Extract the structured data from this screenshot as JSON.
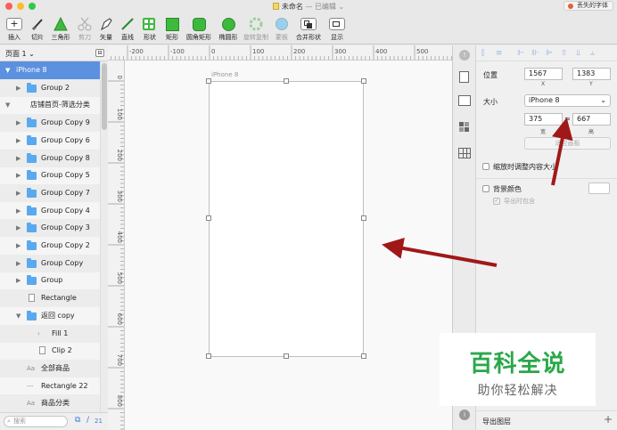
{
  "window": {
    "title": "未命名",
    "title_suffix": "— 已编辑",
    "lost_fonts": "丢失的字体"
  },
  "toolbar": [
    {
      "id": "insert",
      "label": "插入",
      "icon": "plus-icon"
    },
    {
      "id": "slice",
      "label": "切片",
      "icon": "knife-icon"
    },
    {
      "id": "triangle",
      "label": "三角形",
      "icon": "triangle-icon"
    },
    {
      "id": "scissors",
      "label": "剪刀",
      "icon": "scissors-icon",
      "disabled": true
    },
    {
      "id": "vector",
      "label": "矢量",
      "icon": "pen-icon"
    },
    {
      "id": "line",
      "label": "直线",
      "icon": "line-icon"
    },
    {
      "id": "shape",
      "label": "形状",
      "icon": "shapes-icon"
    },
    {
      "id": "rect",
      "label": "矩形",
      "icon": "rectangle-icon"
    },
    {
      "id": "roundrect",
      "label": "圆角矩形",
      "icon": "rounded-rectangle-icon"
    },
    {
      "id": "oval",
      "label": "椭圆形",
      "icon": "oval-icon"
    },
    {
      "id": "rotatecopy",
      "label": "旋转复制",
      "icon": "gear-icon",
      "disabled": true
    },
    {
      "id": "mask",
      "label": "蒙板",
      "icon": "mask-icon",
      "disabled": true
    },
    {
      "id": "combine",
      "label": "合并形状",
      "icon": "combine-icon"
    },
    {
      "id": "view",
      "label": "显示",
      "icon": "view-icon"
    }
  ],
  "page_selector": "页面 1",
  "layers": [
    {
      "name": "iPhone 8",
      "arrow": "▼",
      "selected": true
    },
    {
      "name": "Group 2",
      "arrow": "▶",
      "folder": true
    },
    {
      "name": "店铺首页-筛选分类",
      "arrow": "▼"
    },
    {
      "name": "Group Copy 9",
      "arrow": "▶",
      "folder": true
    },
    {
      "name": "Group Copy 6",
      "arrow": "▶",
      "folder": true
    },
    {
      "name": "Group Copy 8",
      "arrow": "▶",
      "folder": true
    },
    {
      "name": "Group Copy 5",
      "arrow": "▶",
      "folder": true
    },
    {
      "name": "Group Copy 7",
      "arrow": "▶",
      "folder": true
    },
    {
      "name": "Group Copy 4",
      "arrow": "▶",
      "folder": true
    },
    {
      "name": "Group Copy 3",
      "arrow": "▶",
      "folder": true
    },
    {
      "name": "Group Copy 2",
      "arrow": "▶",
      "folder": true
    },
    {
      "name": "Group Copy",
      "arrow": "▶",
      "folder": true
    },
    {
      "name": "Group",
      "arrow": "▶",
      "folder": true
    },
    {
      "name": "Rectangle",
      "arrow": ""
    },
    {
      "name": "返回 copy",
      "arrow": "▼",
      "folder": true
    },
    {
      "name": "Fill 1",
      "arrow": ""
    },
    {
      "name": "Clip 2",
      "arrow": ""
    },
    {
      "name": "全部商品",
      "arrow": ""
    },
    {
      "name": "Rectangle 22",
      "arrow": ""
    },
    {
      "name": "商品分类",
      "arrow": ""
    }
  ],
  "layer_icons": [
    "",
    "",
    "",
    "",
    "",
    "",
    "",
    "",
    "",
    "",
    "",
    "",
    "",
    "",
    "",
    "‹",
    "",
    "Aa",
    "---",
    "Aa"
  ],
  "search_placeholder": "搜索",
  "layer_count": "21",
  "ruler_h": [
    "-200",
    "-100",
    "0",
    "100",
    "200",
    "300",
    "400",
    "500"
  ],
  "ruler_v": [
    "0",
    "100",
    "200",
    "300",
    "400",
    "500",
    "600",
    "700",
    "800"
  ],
  "artboard_label": "iPhone 8",
  "inspector": {
    "position_label": "位置",
    "x": "1567",
    "y": "1383",
    "x_label": "X",
    "y_label": "Y",
    "size_label": "大小",
    "device": "iPhone 8",
    "width": "375",
    "height": "667",
    "width_label": "宽",
    "height_label": "高",
    "lock_symbol": "≈",
    "fit_button": "适应画板",
    "resize_label": "缩放时调整内容大小",
    "bg_label": "背景颜色",
    "export_bg_label": "导出时包含",
    "export_layer": "导出图层",
    "add_symbol": "+"
  },
  "watermark": {
    "title": "百科全说",
    "subtitle": "助你轻松解决"
  },
  "colors": {
    "selection": "#5c91e0",
    "accent_green": "#2aa84a",
    "arrow_red": "#a01818"
  }
}
